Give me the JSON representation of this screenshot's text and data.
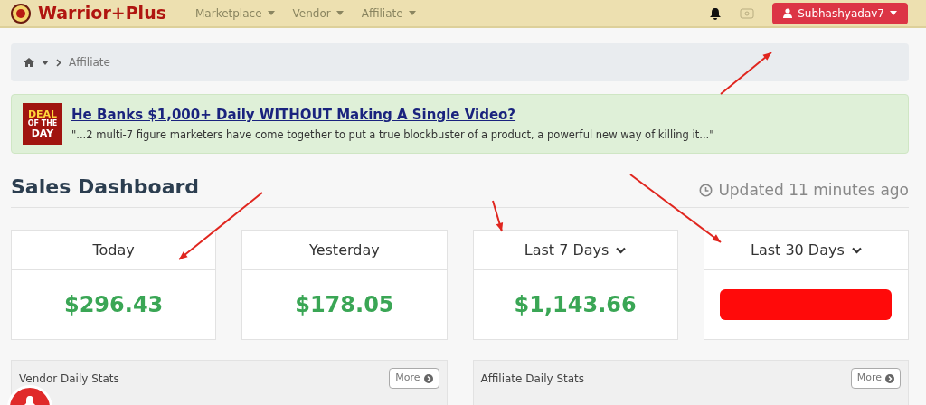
{
  "navbar": {
    "brand": "Warrior+Plus",
    "menu": [
      {
        "label": "Marketplace"
      },
      {
        "label": "Vendor"
      },
      {
        "label": "Affiliate"
      }
    ],
    "user": "Subhashyadav7"
  },
  "breadcrumb": {
    "current": "Affiliate"
  },
  "deal": {
    "badge_top": "DEAL",
    "badge_mid": "OF THE",
    "badge_bottom": "DAY",
    "title": "He Banks $1,000+ Daily WITHOUT Making A Single Video?",
    "quote": "\"...2 multi-7 figure marketers have come together to put a true blockbuster of a product, a powerful new way of killing it...\""
  },
  "dashboard": {
    "title": "Sales Dashboard",
    "updated": "Updated 11 minutes ago"
  },
  "cards": [
    {
      "label": "Today",
      "dropdown": false,
      "value": "$296.43",
      "redacted": false
    },
    {
      "label": "Yesterday",
      "dropdown": false,
      "value": "$178.05",
      "redacted": false
    },
    {
      "label": "Last 7 Days",
      "dropdown": true,
      "value": "$1,143.66",
      "redacted": false
    },
    {
      "label": "Last 30 Days",
      "dropdown": true,
      "redacted": true
    }
  ],
  "panels": [
    {
      "title": "Vendor Daily Stats",
      "button": "More"
    },
    {
      "title": "Affiliate Daily Stats",
      "button": "More"
    }
  ]
}
